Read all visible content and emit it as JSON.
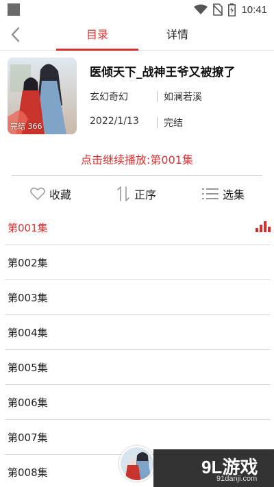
{
  "status_bar": {
    "time": "10:41"
  },
  "nav": {
    "tabs": [
      {
        "label": "目录",
        "active": true
      },
      {
        "label": "详情",
        "active": false
      }
    ]
  },
  "book": {
    "title": "医倾天下_战神王爷又被撩了",
    "cover_caption": "完结 366",
    "genre": "玄幻奇幻",
    "author": "如澜若溪",
    "date": "2022/1/13",
    "status": "完结"
  },
  "continue_play": "点击继续播放:第001集",
  "actions": {
    "favorite": "收藏",
    "order": "正序",
    "select": "选集"
  },
  "episodes": [
    {
      "label": "第001集",
      "playing": true
    },
    {
      "label": "第002集"
    },
    {
      "label": "第003集"
    },
    {
      "label": "第004集"
    },
    {
      "label": "第005集"
    },
    {
      "label": "第006集"
    },
    {
      "label": "第007集"
    },
    {
      "label": "第008集"
    }
  ],
  "watermark": {
    "logo": "9L游戏",
    "url": "91danji.com"
  },
  "colors": {
    "accent": "#d9302e",
    "divider": "#d8d8d8"
  }
}
